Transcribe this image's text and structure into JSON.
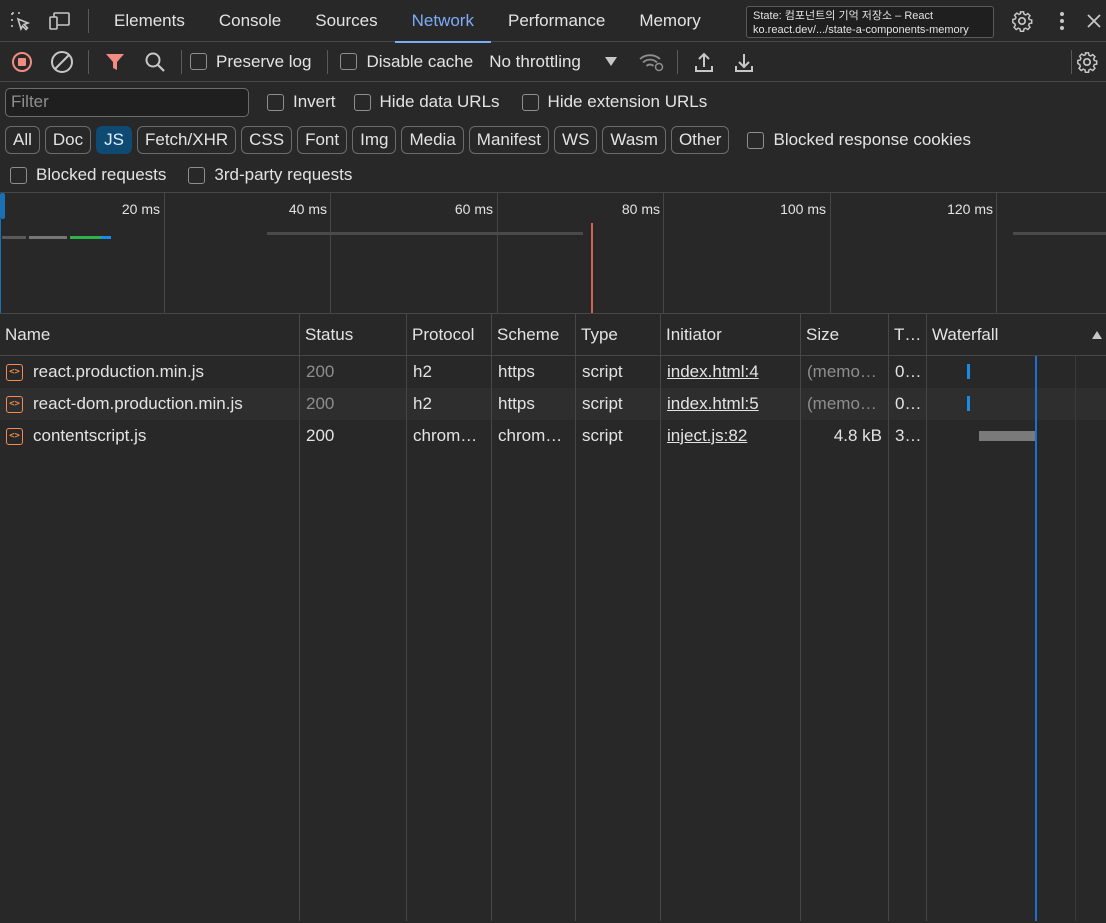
{
  "tabbar": {
    "tabs": [
      {
        "label": "Elements",
        "active": false
      },
      {
        "label": "Console",
        "active": false
      },
      {
        "label": "Sources",
        "active": false
      },
      {
        "label": "Network",
        "active": true
      },
      {
        "label": "Performance",
        "active": false
      },
      {
        "label": "Memory",
        "active": false
      }
    ],
    "tooltip_line1": "State: 컴포넌트의 기억 저장소 – React",
    "tooltip_line2": "ko.react.dev/.../state-a-components-memory"
  },
  "toolbar": {
    "preserve_log": "Preserve log",
    "disable_cache": "Disable cache",
    "throttling": "No throttling"
  },
  "filter": {
    "placeholder": "Filter",
    "invert": "Invert",
    "hide_data_urls": "Hide data URLs",
    "hide_extension_urls": "Hide extension URLs"
  },
  "type_filters": [
    {
      "label": "All",
      "active": false
    },
    {
      "label": "Doc",
      "active": false
    },
    {
      "label": "JS",
      "active": true
    },
    {
      "label": "Fetch/XHR",
      "active": false
    },
    {
      "label": "CSS",
      "active": false
    },
    {
      "label": "Font",
      "active": false
    },
    {
      "label": "Img",
      "active": false
    },
    {
      "label": "Media",
      "active": false
    },
    {
      "label": "Manifest",
      "active": false
    },
    {
      "label": "WS",
      "active": false
    },
    {
      "label": "Wasm",
      "active": false
    },
    {
      "label": "Other",
      "active": false
    }
  ],
  "blocked_response_cookies": "Blocked response cookies",
  "blocked_requests": "Blocked requests",
  "third_party_requests": "3rd-party requests",
  "overview": {
    "ticks": [
      "20 ms",
      "40 ms",
      "60 ms",
      "80 ms",
      "100 ms",
      "120 ms"
    ]
  },
  "table": {
    "headers": [
      "Name",
      "Status",
      "Protocol",
      "Scheme",
      "Type",
      "Initiator",
      "Size",
      "T…",
      "Waterfall"
    ],
    "rows": [
      {
        "name": "react.production.min.js",
        "status": "200",
        "protocol": "h2",
        "scheme": "https",
        "type": "script",
        "initiator": "index.html:4",
        "size": "(memo…",
        "time": "0…"
      },
      {
        "name": "react-dom.production.min.js",
        "status": "200",
        "protocol": "h2",
        "scheme": "https",
        "type": "script",
        "initiator": "index.html:5",
        "size": "(memo…",
        "time": "0…"
      },
      {
        "name": "contentscript.js",
        "status": "200",
        "protocol": "chrom…",
        "scheme": "chrom…",
        "type": "script",
        "initiator": "inject.js:82",
        "size": "4.8 kB",
        "time": "3…"
      }
    ]
  },
  "colors": {
    "accent": "#7cacf8",
    "record_red": "#f28b82",
    "js_chip": "#0f4a73",
    "waterfall_blue": "#1a8ce8"
  }
}
